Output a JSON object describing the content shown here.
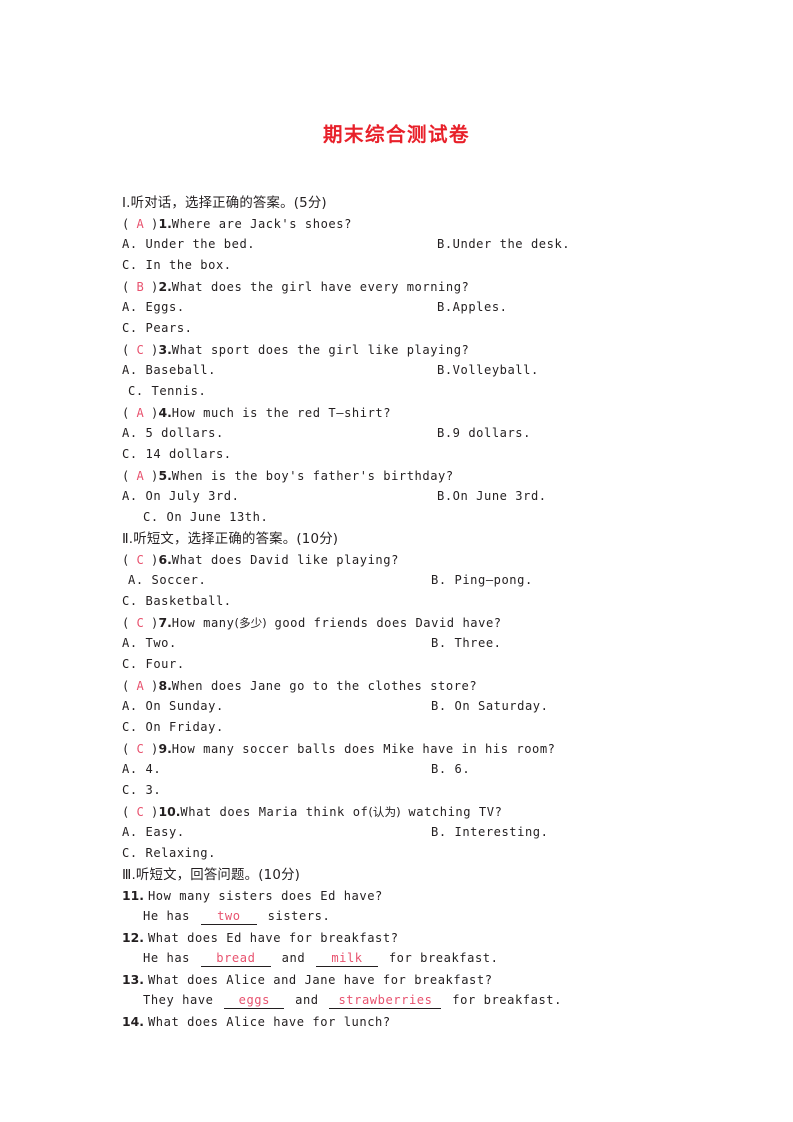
{
  "document": {
    "title": "期末综合测试卷",
    "title_color": "#e8202a",
    "answer_color": "#e8536f",
    "text_color": "#231f20",
    "page_background": "#ffffff"
  },
  "sections": [
    {
      "id": "section-1",
      "roman": "Ⅰ",
      "heading": ".听对话，选择正确的答案。(5分)",
      "questions": [
        {
          "answer": "A",
          "number": "1.",
          "stem": "Where are Jack's shoes?",
          "option_a": "A. Under the bed.",
          "option_b": "B.Under the desk.",
          "option_c": "C. In the box."
        },
        {
          "answer": "B",
          "number": "2.",
          "stem": "What does the girl have every morning?",
          "option_a": "A. Eggs.",
          "option_b": "B.Apples.",
          "option_c": "C. Pears."
        },
        {
          "answer": "C",
          "number": "3.",
          "stem": "What sport does the girl like playing?",
          "option_a": "A. Baseball.",
          "option_b": "B.Volleyball.",
          "option_c": "C. Tennis."
        },
        {
          "answer": "A",
          "number": "4.",
          "stem": "How much is the red T—shirt?",
          "option_a": "A. 5 dollars.",
          "option_b": "B.9 dollars.",
          "option_c": "C. 14 dollars."
        },
        {
          "answer": "A",
          "number": "5.",
          "stem": "When is the boy's father's birthday?",
          "option_a": "A. On July 3rd.",
          "option_b": "B.On June 3rd.",
          "option_c": "C. On June 13th."
        }
      ]
    },
    {
      "id": "section-2",
      "roman": "Ⅱ",
      "heading": ".听短文，选择正确的答案。(10分)",
      "questions": [
        {
          "answer": "C",
          "number": "6.",
          "stem": "What does David like playing?",
          "option_a": "A. Soccer.",
          "option_b": "B. Ping—pong.",
          "option_c": "C. Basketball."
        },
        {
          "answer": "C",
          "number": "7.",
          "stem_pre": "How many",
          "stem_gloss": "(多少)",
          "stem_post": " good friends does David have?",
          "option_a": "A. Two.",
          "option_b": "B. Three.",
          "option_c": "C. Four."
        },
        {
          "answer": "A",
          "number": "8.",
          "stem": "When does Jane go to the clothes store?",
          "option_a": "A. On Sunday.",
          "option_b": "B. On Saturday.",
          "option_c": "C. On Friday."
        },
        {
          "answer": "C",
          "number": "9.",
          "stem": "How many soccer balls does Mike have in his room?",
          "option_a": "A. 4.",
          "option_b": "B. 6.",
          "option_c": "C. 3."
        },
        {
          "answer": "C",
          "number": "10.",
          "stem_pre": "What does Maria think of",
          "stem_gloss": "(认为)",
          "stem_post": " watching TV?",
          "option_a": "A. Easy.",
          "option_b": "B. Interesting.",
          "option_c": "C. Relaxing."
        }
      ]
    },
    {
      "id": "section-3",
      "roman": "Ⅲ",
      "heading": ".听短文，回答问题。(10分)",
      "items": [
        {
          "number": "11.",
          "question": "How many sisters does Ed have?",
          "answer_pre": "He has ",
          "blank1": "two",
          "answer_mid": "",
          "blank2": null,
          "answer_post": " sisters."
        },
        {
          "number": "12.",
          "question": "What does Ed have for breakfast?",
          "answer_pre": "He has ",
          "blank1": "bread",
          "answer_mid": " and ",
          "blank2": "milk",
          "answer_post": " for breakfast."
        },
        {
          "number": "13.",
          "question": "What does Alice and Jane have for breakfast?",
          "answer_pre": "They have ",
          "blank1": "eggs",
          "answer_mid": " and ",
          "blank2": "strawberries",
          "answer_post": " for breakfast."
        },
        {
          "number": "14.",
          "question": "What does Alice have for lunch?",
          "answer_pre": null,
          "blank1": null,
          "answer_mid": null,
          "blank2": null,
          "answer_post": null
        }
      ]
    }
  ]
}
